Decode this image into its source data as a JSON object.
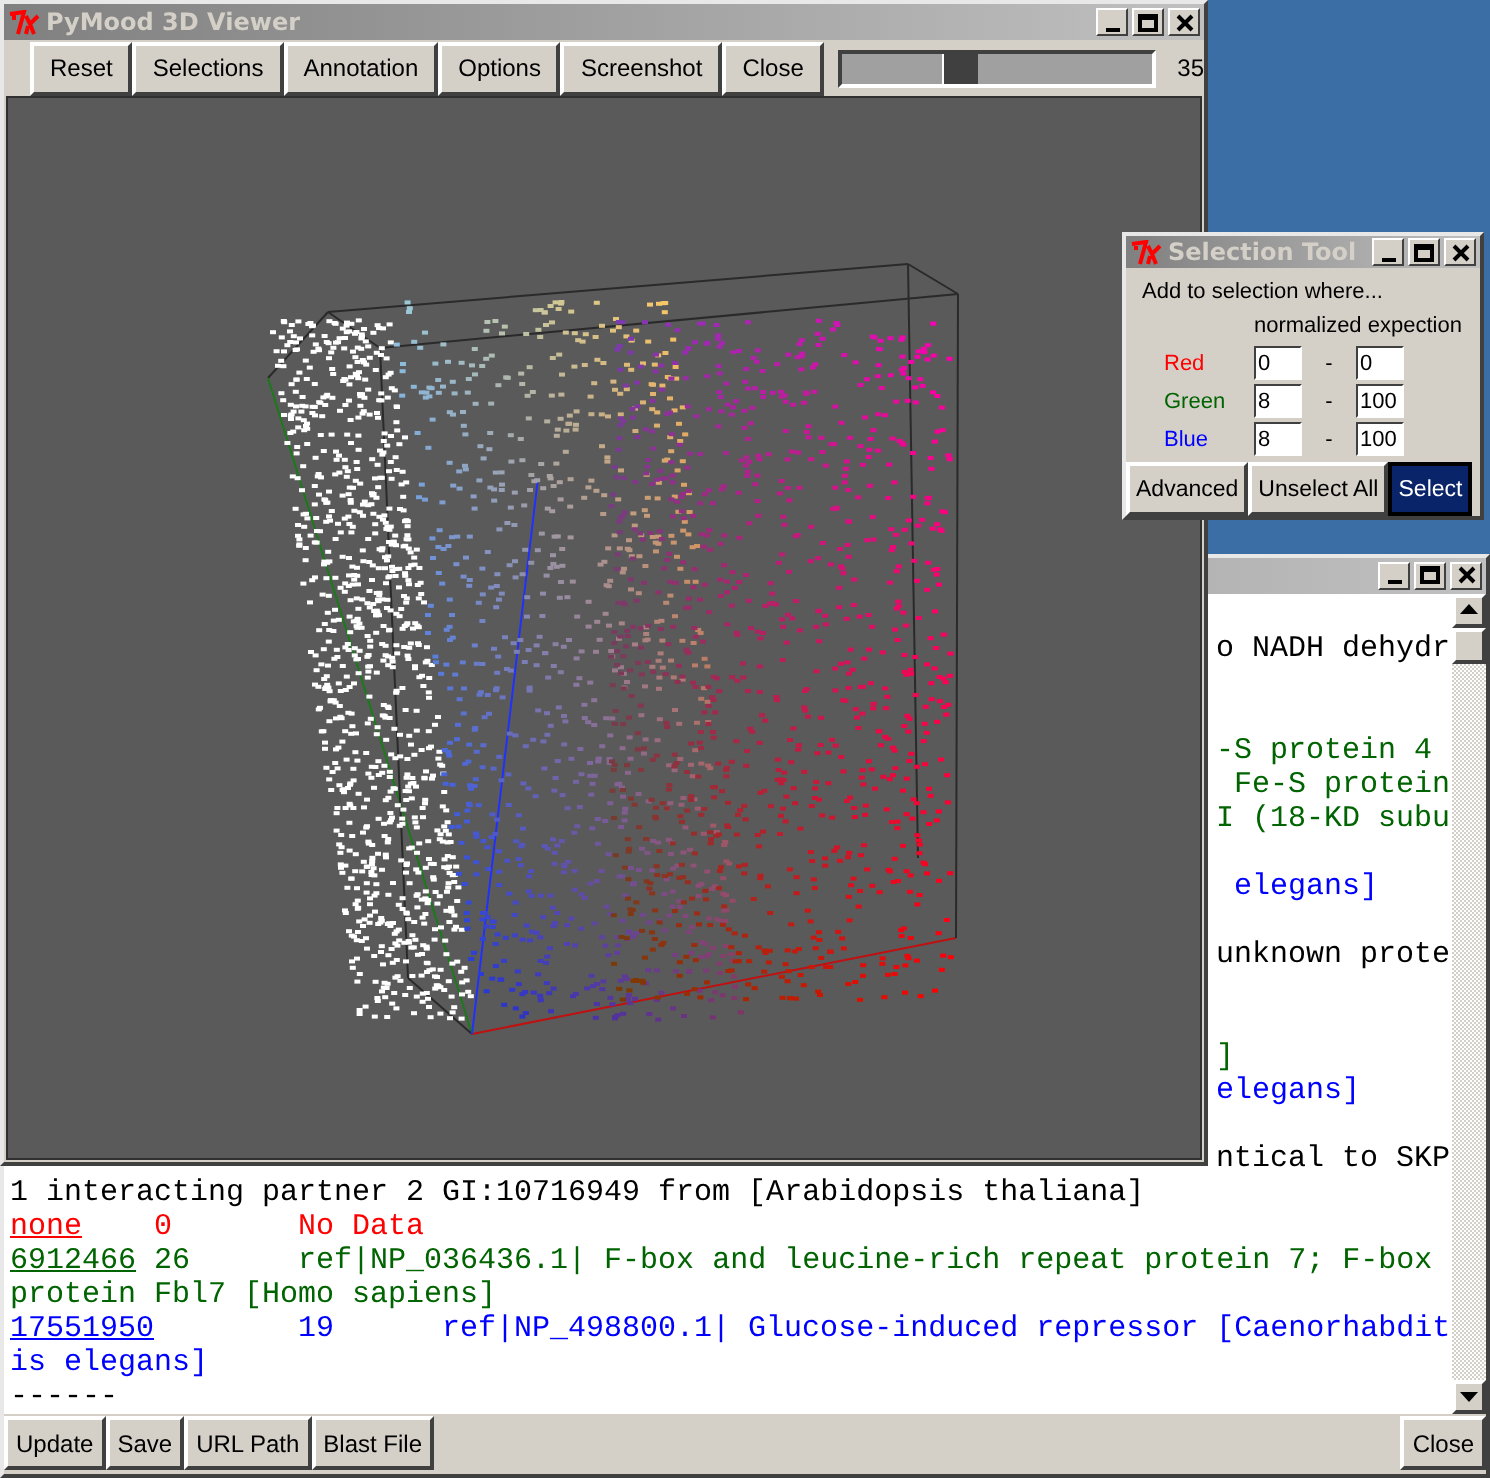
{
  "viewer": {
    "title": "PyMood 3D Viewer",
    "buttons": [
      "Reset",
      "Selections",
      "Annotation",
      "Options",
      "Screenshot",
      "Close"
    ],
    "zoom_slider": {
      "level": 0.37,
      "reading": "35"
    }
  },
  "selection_tool": {
    "title": "Selection Tool",
    "prompt": "Add to selection where...",
    "header": "normalized expection",
    "rows": [
      {
        "label": "Red",
        "color": "#ff0000",
        "from": "0",
        "separator": "-",
        "to": "0"
      },
      {
        "label": "Green",
        "color": "#006400",
        "from": "8",
        "separator": "-",
        "to": "100"
      },
      {
        "label": "Blue",
        "color": "#0000ff",
        "from": "8",
        "separator": "-",
        "to": "100"
      }
    ],
    "buttons": [
      {
        "label": "Advanced",
        "selected": false
      },
      {
        "label": "Unselect All",
        "selected": false
      },
      {
        "label": "Select",
        "selected": true
      }
    ]
  },
  "results": {
    "lines": [
      {
        "kind": "blank"
      },
      {
        "kind": "cut",
        "color": "#000000",
        "text": "o NADH dehydr"
      },
      {
        "kind": "blank"
      },
      {
        "kind": "blank"
      },
      {
        "kind": "cut",
        "color": "#006400",
        "text": "-S protein 4"
      },
      {
        "kind": "cut",
        "color": "#006400",
        "text": " Fe-S protein"
      },
      {
        "kind": "cut",
        "color": "#006400",
        "text": "I (18-KD subu"
      },
      {
        "kind": "blank"
      },
      {
        "kind": "cut",
        "color": "#0000ff",
        "text": " elegans]"
      },
      {
        "kind": "blank"
      },
      {
        "kind": "cut",
        "color": "#000000",
        "text": "unknown prote"
      },
      {
        "kind": "blank"
      },
      {
        "kind": "blank"
      },
      {
        "kind": "cut",
        "color": "#006400",
        "text": "]"
      },
      {
        "kind": "cut",
        "color": "#0000ff",
        "text": "elegans]"
      },
      {
        "kind": "blank"
      },
      {
        "kind": "cut",
        "color": "#000000",
        "text": "ntical to SKP"
      },
      {
        "kind": "row",
        "color": "#000000",
        "segments": [
          {
            "text": "1 interacting partner 2 GI:10716949 from [Arabidopsis thaliana]",
            "link": false
          }
        ]
      },
      {
        "kind": "row",
        "color": "#ff0000",
        "segments": [
          {
            "text": "none",
            "link": true
          },
          {
            "text": "0",
            "link": false
          },
          {
            "text": "No Data",
            "link": false
          }
        ]
      },
      {
        "kind": "row",
        "color": "#006400",
        "segments": [
          {
            "text": "6912466",
            "link": true
          },
          {
            "text": "26",
            "link": false
          },
          {
            "text": "ref|NP_036436.1| F-box and leucine-rich repeat protein 7; F-box",
            "link": false
          }
        ]
      },
      {
        "kind": "row",
        "color": "#006400",
        "segments": [
          {
            "text": "protein Fbl7 [Homo sapiens]",
            "link": false
          }
        ]
      },
      {
        "kind": "row",
        "color": "#0000ff",
        "segments": [
          {
            "text": "17551950",
            "link": true
          },
          {
            "text": "19",
            "link": false
          },
          {
            "text": "ref|NP_498800.1| Glucose-induced repressor [Caenorhabdit",
            "link": false
          }
        ]
      },
      {
        "kind": "row",
        "color": "#0000ff",
        "segments": [
          {
            "text": "is elegans]",
            "link": false
          }
        ]
      },
      {
        "kind": "row",
        "color": "#000000",
        "segments": [
          {
            "text": "------",
            "link": false
          }
        ]
      }
    ],
    "buttons": [
      "Update",
      "Save",
      "URL Path",
      "Blast File"
    ],
    "close_button": "Close"
  }
}
